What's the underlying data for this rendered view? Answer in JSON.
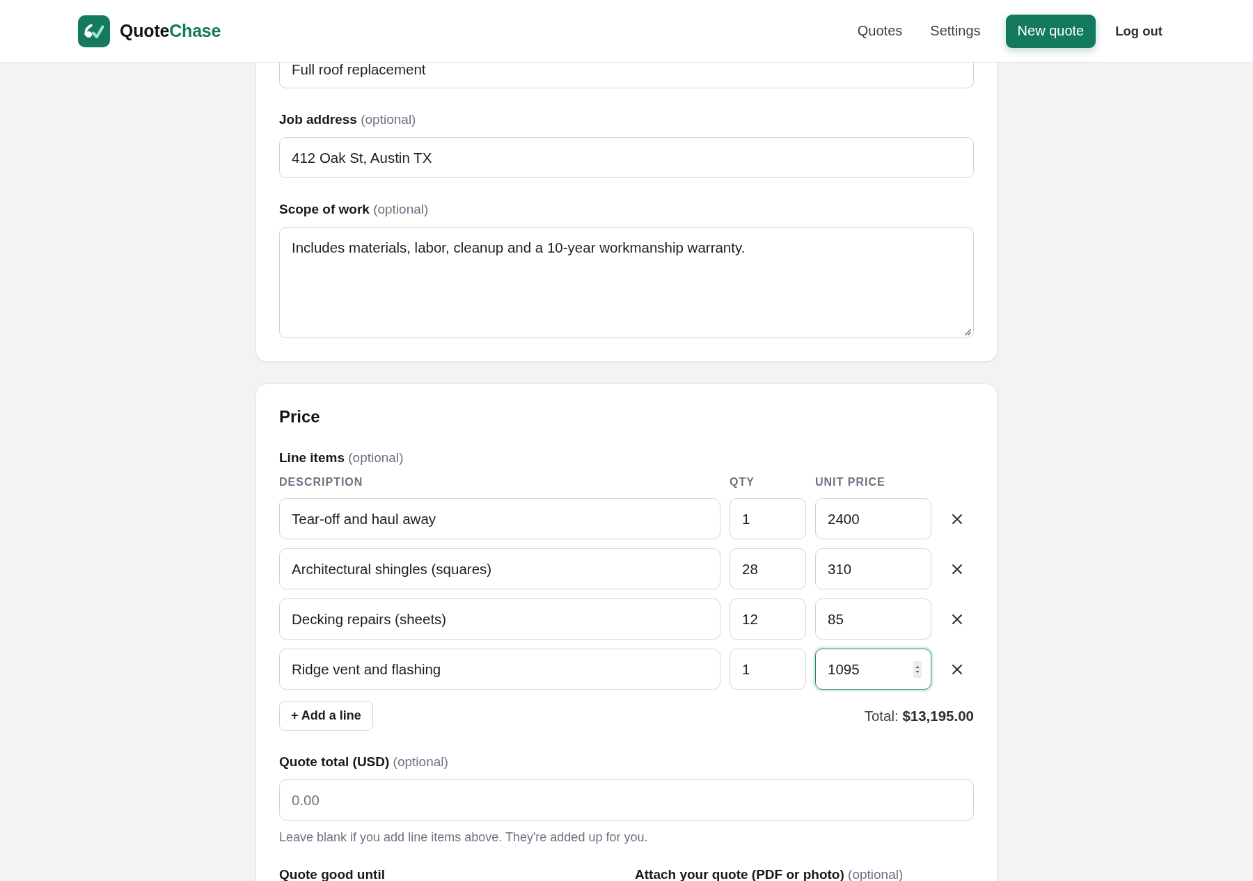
{
  "header": {
    "brand": {
      "name_start": "Quote",
      "name_end": "Chase"
    },
    "nav": [
      {
        "label": "Quotes",
        "kind": "link"
      },
      {
        "label": "Settings",
        "kind": "link"
      },
      {
        "label": "New quote",
        "kind": "primary"
      },
      {
        "label": "Log out",
        "kind": "ghost"
      }
    ]
  },
  "job_card": {
    "title_field": {
      "value": "Full roof replacement"
    },
    "fields": [
      {
        "label": "Job address",
        "note": "(optional)",
        "value": "412 Oak St, Austin TX",
        "kind": "input"
      },
      {
        "label": "Scope of work",
        "note": "(optional)",
        "value": "Includes materials, labor, cleanup and a 10-year workmanship warranty.",
        "kind": "textarea"
      }
    ]
  },
  "price_card": {
    "title": "Price",
    "line_items": {
      "label": "Line items",
      "note": "(optional)",
      "columns": [
        "DESCRIPTION",
        "QTY",
        "UNIT PRICE"
      ],
      "rows": [
        {
          "description": "Tear-off and haul away",
          "qty": "1",
          "unit_price": "2400",
          "focused": false
        },
        {
          "description": "Architectural shingles (squares)",
          "qty": "28",
          "unit_price": "310",
          "focused": false
        },
        {
          "description": "Decking repairs (sheets)",
          "qty": "12",
          "unit_price": "85",
          "focused": false
        },
        {
          "description": "Ridge vent and flashing",
          "qty": "1",
          "unit_price": "1095",
          "focused": true
        }
      ],
      "add_button": "+ Add a line",
      "total": "Total: **$13,195.00**"
    },
    "quote_total": {
      "label": "Quote total (USD)",
      "note": "(optional)",
      "placeholder": "0.00",
      "help": "Leave blank if you add line items above. They're added up for you."
    },
    "bottom_fields": [
      {
        "label": "Quote good until"
      },
      {
        "label": "Attach your quote (PDF or photo)",
        "note": "(optional)"
      }
    ]
  }
}
